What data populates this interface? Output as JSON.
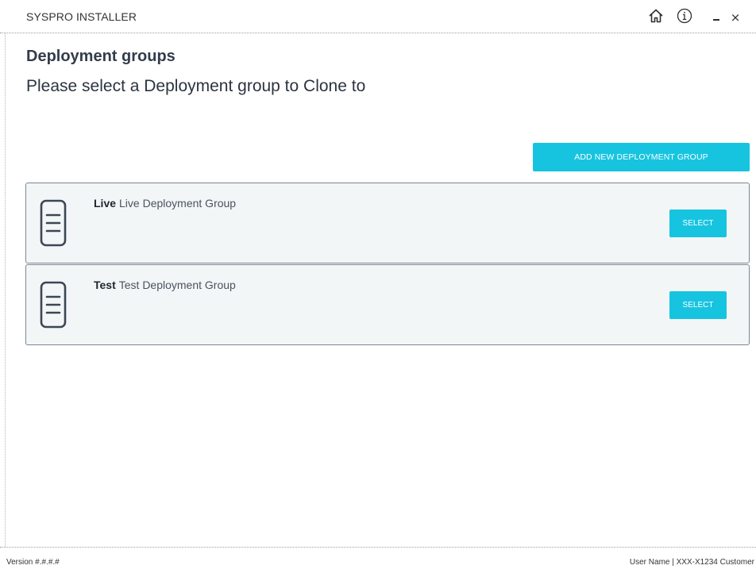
{
  "window": {
    "title": "SYSPRO INSTALLER",
    "controls": {
      "home_icon": "home-icon",
      "info_icon": "info-icon",
      "minimize_icon": "minimize-icon",
      "close_symbol": "×"
    }
  },
  "page": {
    "heading": "Deployment groups",
    "subheading": "Please select a Deployment group to Clone to"
  },
  "actions": {
    "add_label": "ADD NEW DEPLOYMENT GROUP"
  },
  "groups": [
    {
      "name": "Live",
      "description": "Live Deployment Group",
      "select_label": "SELECT",
      "icon": "document-icon"
    },
    {
      "name": "Test",
      "description": "Test Deployment Group",
      "select_label": "SELECT",
      "icon": "document-icon"
    }
  ],
  "footer": {
    "version": "Version #.#.#.#",
    "user": "User Name | XXX-X1234 Customer"
  },
  "colors": {
    "accent": "#17c4e0",
    "card_background": "#f3f6f7",
    "text": "#333d4b"
  }
}
